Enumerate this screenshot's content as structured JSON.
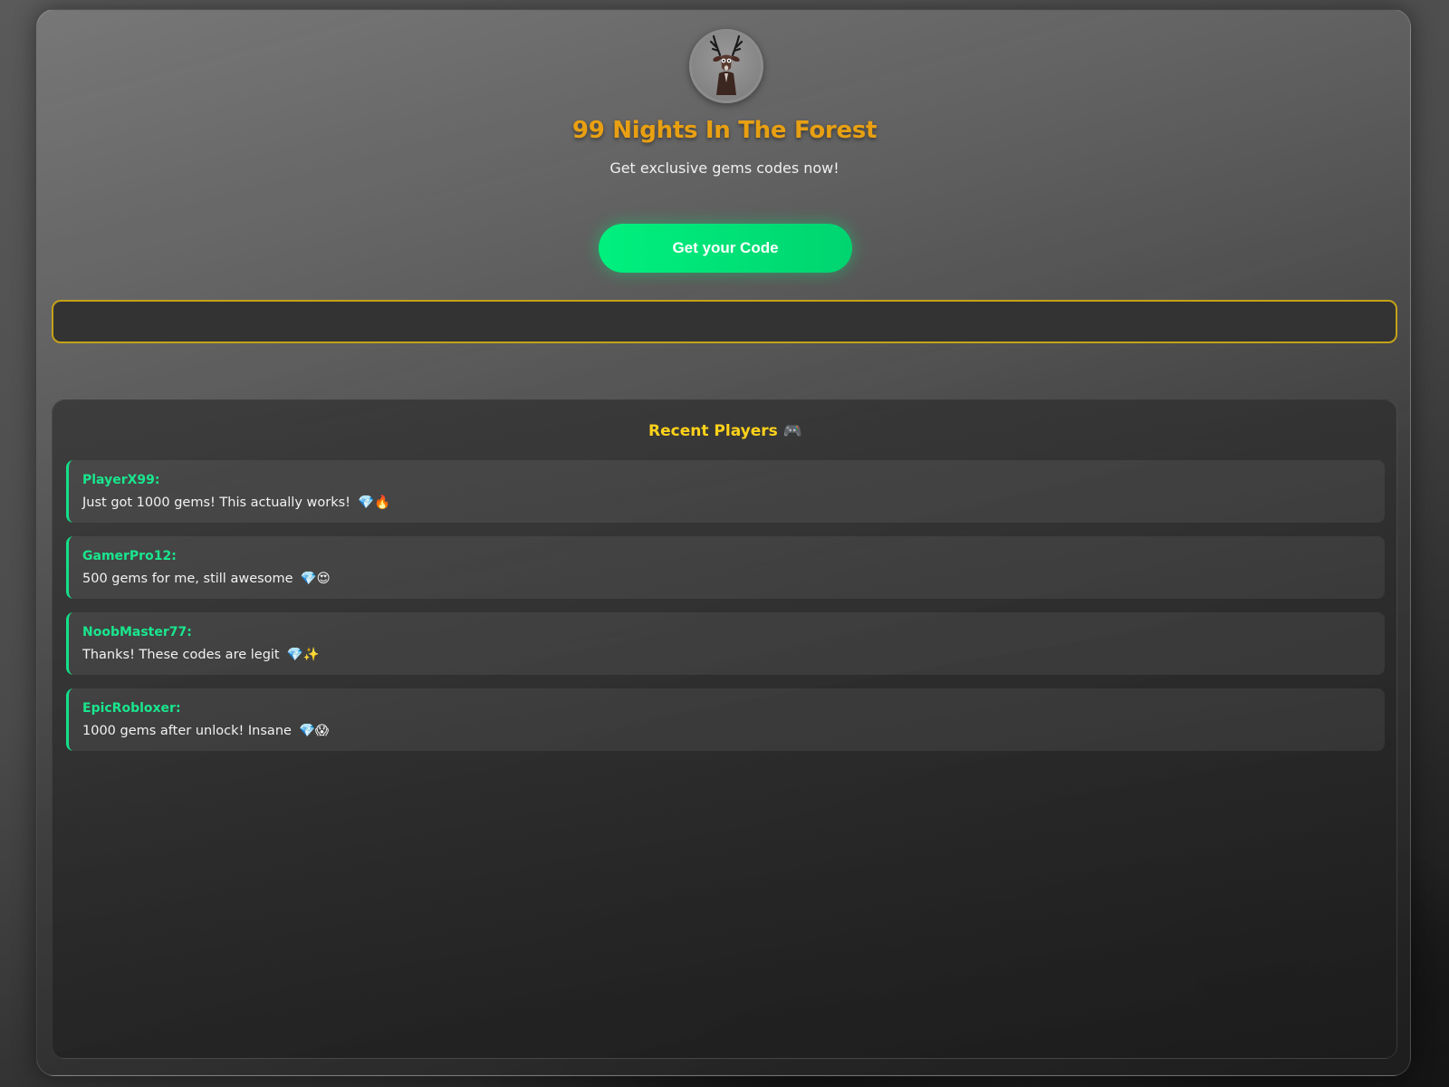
{
  "header": {
    "avatar_icon": "deer-icon",
    "title": "99 Nights In The Forest",
    "subtitle": "Get exclusive gems codes now!"
  },
  "cta": {
    "label": "Get your Code"
  },
  "code_box": {
    "value": ""
  },
  "recent_players": {
    "title": "Recent Players",
    "title_emoji": "🎮",
    "items": [
      {
        "name": "PlayerX99:",
        "message": "Just got 1000 gems! This actually works!",
        "emoji": "💎🔥"
      },
      {
        "name": "GamerPro12:",
        "message": "500 gems for me, still awesome",
        "emoji": "💎😍"
      },
      {
        "name": "NoobMaster77:",
        "message": "Thanks! These codes are legit",
        "emoji": "💎✨"
      },
      {
        "name": "EpicRobloxer:",
        "message": "1000 gems after unlock! Insane",
        "emoji": "💎😱"
      }
    ]
  },
  "colors": {
    "title": "#e8a012",
    "cta": "#00e676",
    "accent_green": "#19e68e",
    "code_border": "#c4a218",
    "players_title": "#ffd21a"
  }
}
